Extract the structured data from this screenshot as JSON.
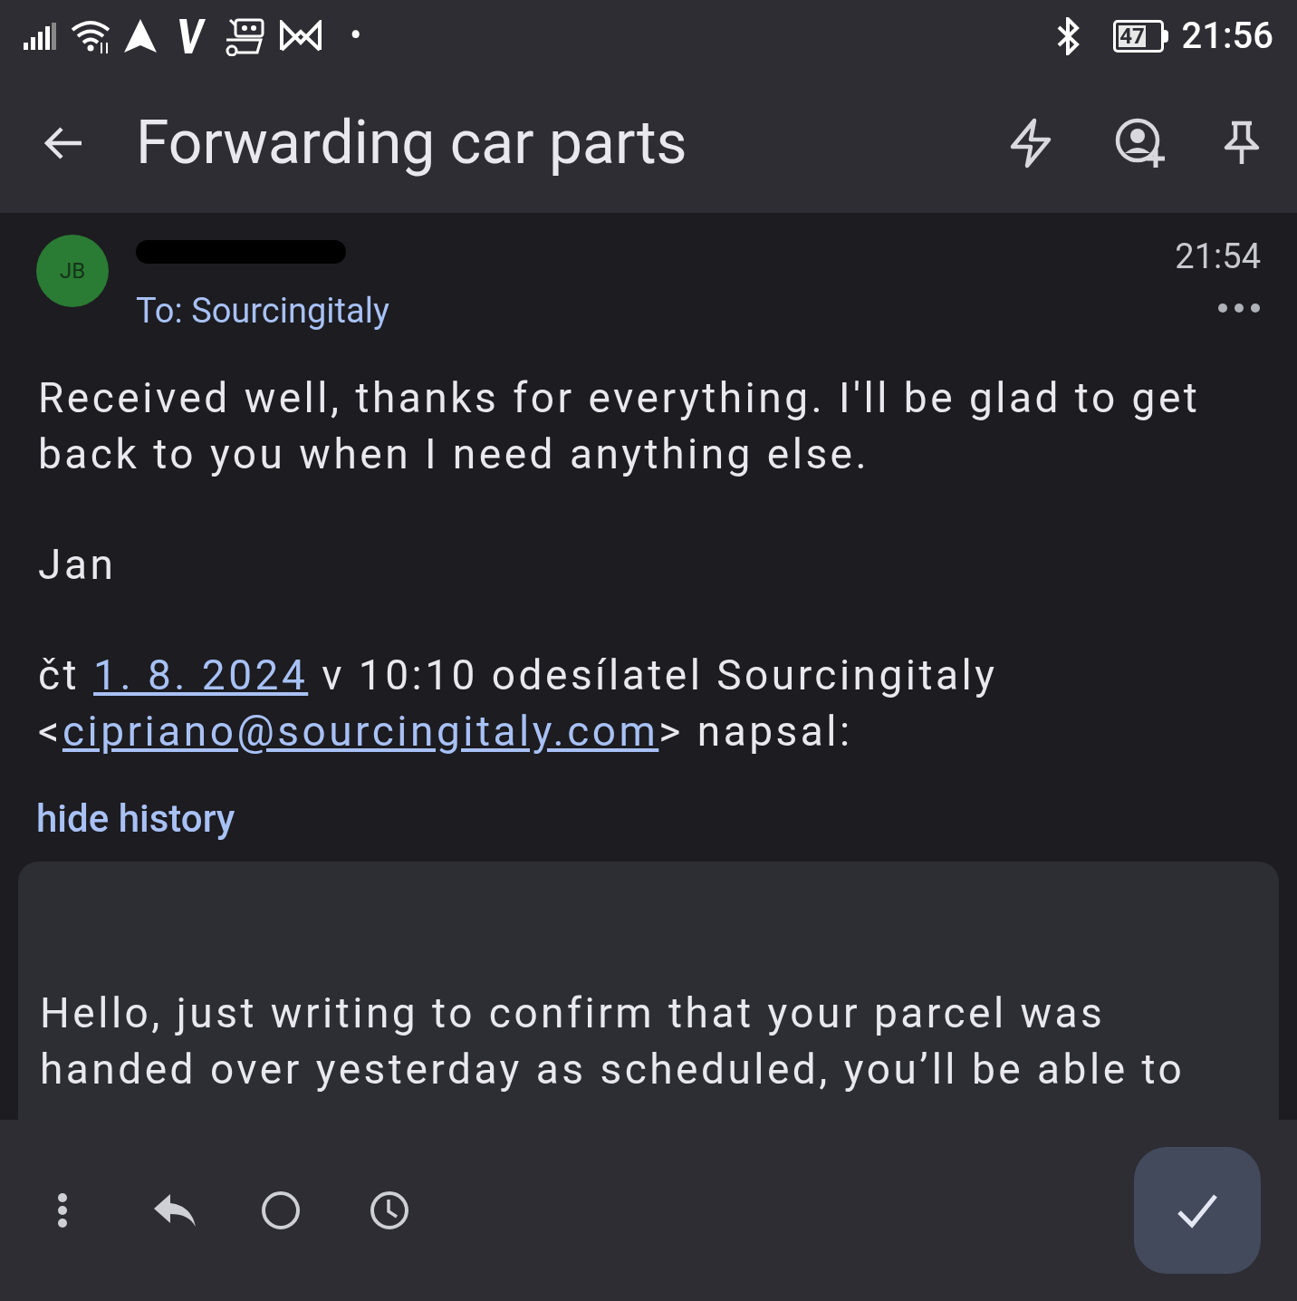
{
  "status_bar": {
    "notification_dot": "•",
    "battery": "47",
    "time": "21:56"
  },
  "header": {
    "title": "Forwarding car parts"
  },
  "message": {
    "avatar": "JB",
    "sender_redacted": true,
    "time": "21:54",
    "to": "To: Sourcingitaly",
    "paragraphs": [
      "Received well, thanks for everything. I'll be glad to get back to you when I need anything else.",
      "Jan"
    ],
    "quote_header": [
      {
        "text": "čt ",
        "link": false
      },
      {
        "text": "1. 8. 2024",
        "link": true
      },
      {
        "text": " v 10:10 odesílatel Sourcingitaly <",
        "link": false
      },
      {
        "text": "cipriano@sourcingitaly.com",
        "link": true
      },
      {
        "text": "> napsal:",
        "link": false
      }
    ],
    "history_toggle": "hide history",
    "quoted": "Hello, just writing to confirm that your parcel was handed over yesterday as scheduled, you’ll be able to"
  }
}
